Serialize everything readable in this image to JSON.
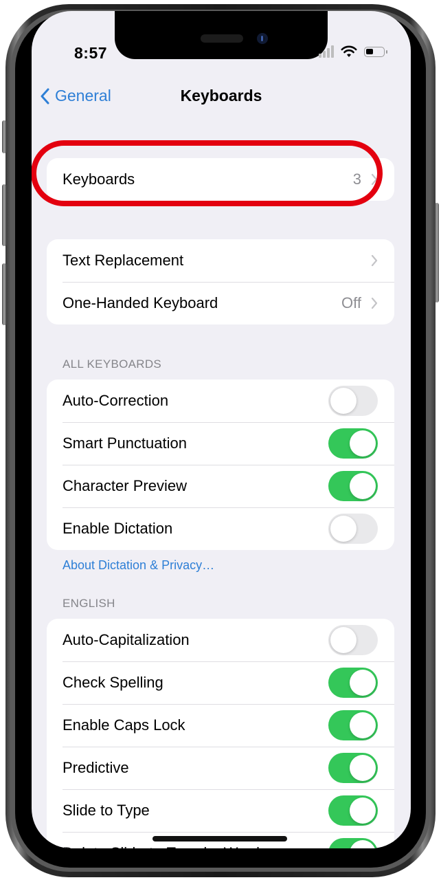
{
  "status_bar": {
    "time": "8:57",
    "icons": [
      "cellular-signal-icon",
      "wifi-icon",
      "battery-icon"
    ],
    "battery_level_fraction": 0.35
  },
  "nav": {
    "back_label": "General",
    "back_icon": "chevron-left-icon",
    "title": "Keyboards"
  },
  "colors": {
    "accent": "#2e7fd6",
    "toggle_on": "#34c759",
    "toggle_off": "#e9e9eb",
    "highlight": "#e3000f",
    "background": "#f0eff5"
  },
  "keyboards_row": {
    "label": "Keyboards",
    "value": "3",
    "highlighted": true
  },
  "group_options": [
    {
      "label": "Text Replacement",
      "value": ""
    },
    {
      "label": "One-Handed Keyboard",
      "value": "Off"
    }
  ],
  "all_keyboards": {
    "header": "ALL KEYBOARDS",
    "items": [
      {
        "label": "Auto-Correction",
        "on": false
      },
      {
        "label": "Smart Punctuation",
        "on": true
      },
      {
        "label": "Character Preview",
        "on": true
      },
      {
        "label": "Enable Dictation",
        "on": false
      }
    ],
    "footer_link": "About Dictation & Privacy…"
  },
  "english": {
    "header": "ENGLISH",
    "items": [
      {
        "label": "Auto-Capitalization",
        "on": false
      },
      {
        "label": "Check Spelling",
        "on": true
      },
      {
        "label": "Enable Caps Lock",
        "on": true
      },
      {
        "label": "Predictive",
        "on": true
      },
      {
        "label": "Slide to Type",
        "on": true
      },
      {
        "label": "Delete Slide-to-Type by Word",
        "on": true
      }
    ]
  }
}
